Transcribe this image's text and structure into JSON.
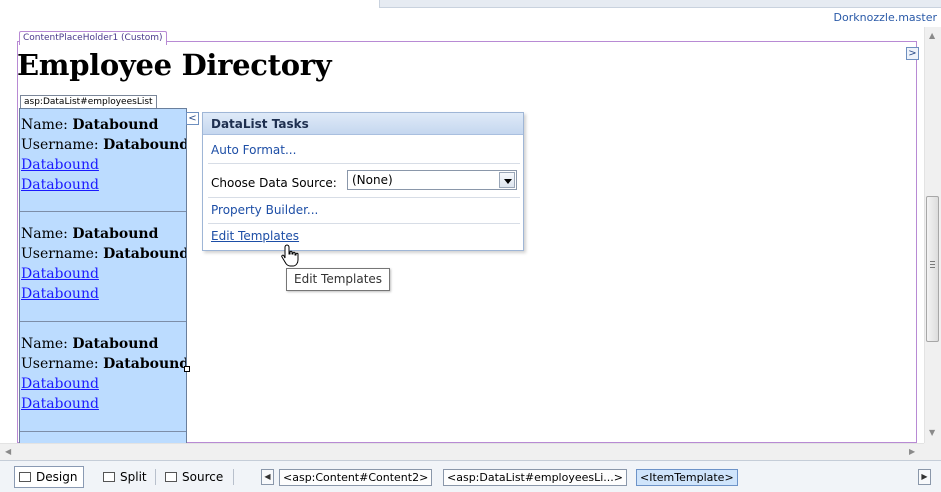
{
  "document": {
    "master_file": "Dorknozzle.master"
  },
  "content_placeholder": {
    "label": "ContentPlaceHolder1 (Custom)"
  },
  "page": {
    "heading": "Employee Directory"
  },
  "datalist": {
    "tag": "asp:DataList#employeesList",
    "items": [
      {
        "name_label": "Name:",
        "name_value": "Databound",
        "username_label": "Username:",
        "username_value": "Databound",
        "link1": "Databound",
        "link2": "Databound"
      },
      {
        "name_label": "Name:",
        "name_value": "Databound",
        "username_label": "Username:",
        "username_value": "Databound",
        "link1": "Databound",
        "link2": "Databound"
      },
      {
        "name_label": "Name:",
        "name_value": "Databound",
        "username_label": "Username:",
        "username_value": "Databound",
        "link1": "Databound",
        "link2": "Databound"
      }
    ]
  },
  "smart_tag": {
    "collapse_glyph": "<",
    "title": "DataList Tasks",
    "auto_format": "Auto Format...",
    "choose_data_source_label": "Choose Data Source:",
    "choose_data_source_value": "(None)",
    "property_builder": "Property Builder...",
    "edit_templates": "Edit Templates"
  },
  "tooltip": {
    "text": "Edit Templates"
  },
  "expand_glyph": ">",
  "bottom_bar": {
    "views": [
      {
        "label": "Design",
        "active": true
      },
      {
        "label": "Split",
        "active": false
      },
      {
        "label": "Source",
        "active": false
      }
    ],
    "breadcrumbs": [
      {
        "label": "<asp:Content#Content2>",
        "selected": false
      },
      {
        "label": "<asp:DataList#employeesLi...>",
        "selected": false
      },
      {
        "label": "<ItemTemplate>",
        "selected": true
      }
    ]
  },
  "colors": {
    "datalist_background": "#bcdcff",
    "placeholder_border": "#b88ad4",
    "link": "#1a1aff",
    "task_link": "#1d4ea6"
  },
  "icons": [
    "collapse-chevron-icon",
    "expand-chevron-icon",
    "dropdown-arrow-icon",
    "hand-cursor-icon",
    "design-view-icon",
    "split-view-icon",
    "source-view-icon"
  ]
}
